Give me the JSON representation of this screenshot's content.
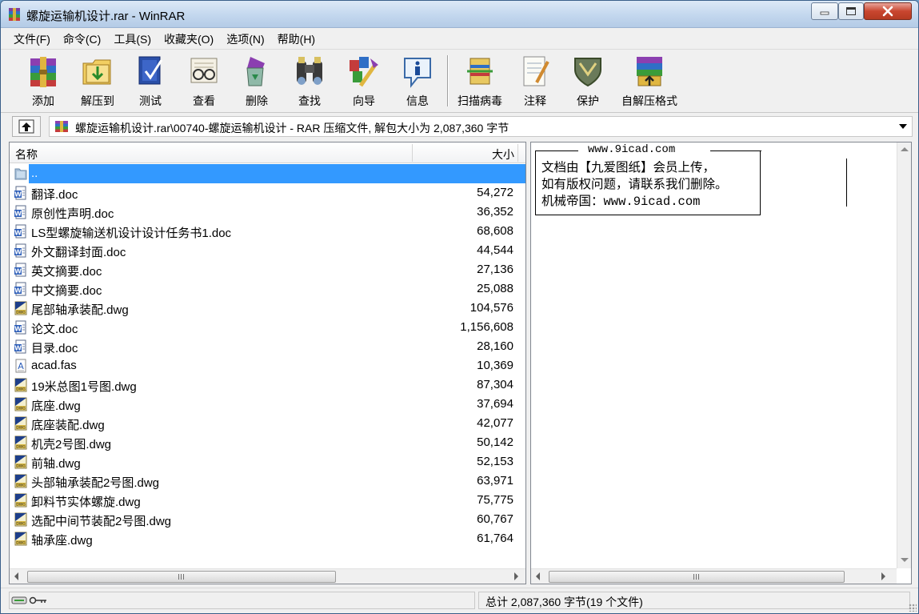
{
  "window": {
    "title": "螺旋运输机设计.rar - WinRAR"
  },
  "menu": [
    "文件(F)",
    "命令(C)",
    "工具(S)",
    "收藏夹(O)",
    "选项(N)",
    "帮助(H)"
  ],
  "toolbar": {
    "add": "添加",
    "extract": "解压到",
    "test": "测试",
    "view": "查看",
    "delete": "删除",
    "find": "查找",
    "wizard": "向导",
    "info": "信息",
    "virusscan": "扫描病毒",
    "comment": "注释",
    "protect": "保护",
    "sfx": "自解压格式"
  },
  "address": {
    "path": "螺旋运输机设计.rar\\00740-螺旋运输机设计 - RAR 压缩文件, 解包大小为 2,087,360 字节"
  },
  "list": {
    "col_name": "名称",
    "col_size": "大小",
    "parent": "..",
    "files": [
      {
        "name": "翻译.doc",
        "size": "54,272",
        "type": "doc"
      },
      {
        "name": "原创性声明.doc",
        "size": "36,352",
        "type": "doc"
      },
      {
        "name": "LS型螺旋输送机设计设计任务书1.doc",
        "size": "68,608",
        "type": "doc"
      },
      {
        "name": "外文翻译封面.doc",
        "size": "44,544",
        "type": "doc"
      },
      {
        "name": "英文摘要.doc",
        "size": "27,136",
        "type": "doc"
      },
      {
        "name": "中文摘要.doc",
        "size": "25,088",
        "type": "doc"
      },
      {
        "name": "尾部轴承装配.dwg",
        "size": "104,576",
        "type": "dwg"
      },
      {
        "name": "论文.doc",
        "size": "1,156,608",
        "type": "doc"
      },
      {
        "name": "目录.doc",
        "size": "28,160",
        "type": "doc"
      },
      {
        "name": "acad.fas",
        "size": "10,369",
        "type": "fas"
      },
      {
        "name": "19米总图1号图.dwg",
        "size": "87,304",
        "type": "dwg"
      },
      {
        "name": "底座.dwg",
        "size": "37,694",
        "type": "dwg"
      },
      {
        "name": "底座装配.dwg",
        "size": "42,077",
        "type": "dwg"
      },
      {
        "name": "机壳2号图.dwg",
        "size": "50,142",
        "type": "dwg"
      },
      {
        "name": "前轴.dwg",
        "size": "52,153",
        "type": "dwg"
      },
      {
        "name": "头部轴承装配2号图.dwg",
        "size": "63,971",
        "type": "dwg"
      },
      {
        "name": "卸料节实体螺旋.dwg",
        "size": "75,775",
        "type": "dwg"
      },
      {
        "name": "选配中间节装配2号图.dwg",
        "size": "60,767",
        "type": "dwg"
      },
      {
        "name": "轴承座.dwg",
        "size": "61,764",
        "type": "dwg"
      }
    ]
  },
  "comment": {
    "domain": "www.9icad.com",
    "line1": "文档由【九爱图纸】会员上传，",
    "line2": "如有版权问题，请联系我们删除。",
    "line3": "机械帝国：www.9icad.com"
  },
  "status": {
    "total": "总计 2,087,360 字节(19 个文件)"
  },
  "colors": {
    "selection": "#3399ff",
    "titlebar": "#c3d7ee",
    "close_button": "#c9462f"
  }
}
